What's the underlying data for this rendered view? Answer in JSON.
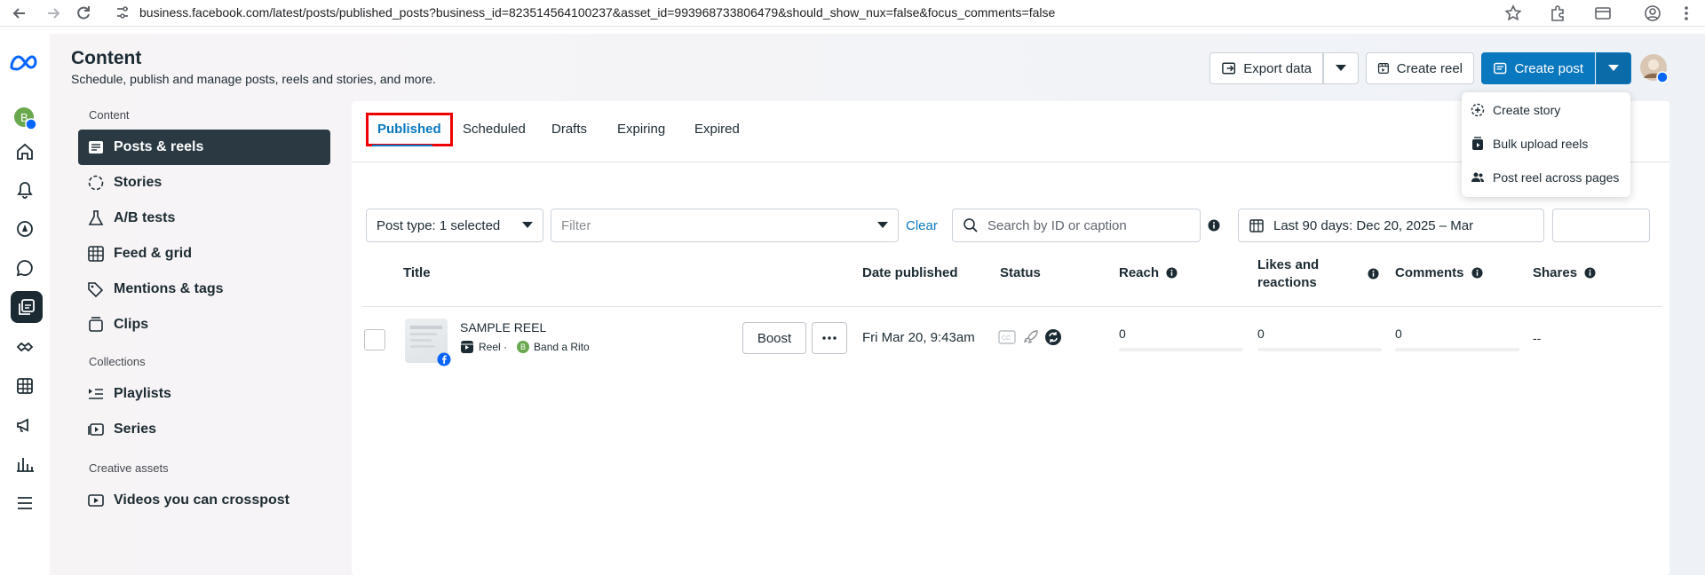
{
  "browser": {
    "url": "business.facebook.com/latest/posts/published_posts?business_id=823514564100237&asset_id=993968733806479&should_show_nux=false&focus_comments=false"
  },
  "header": {
    "title": "Content",
    "subtitle": "Schedule, publish and manage posts, reels and stories, and more.",
    "export_label": "Export data",
    "create_reel_label": "Create reel",
    "create_post_label": "Create post"
  },
  "sidebar": {
    "section_content": "Content",
    "section_collections": "Collections",
    "section_creative": "Creative assets",
    "items": [
      {
        "label": "Posts & reels",
        "icon": "posts-icon"
      },
      {
        "label": "Stories",
        "icon": "stories-icon"
      },
      {
        "label": "A/B tests",
        "icon": "flask-icon"
      },
      {
        "label": "Feed & grid",
        "icon": "grid-icon"
      },
      {
        "label": "Mentions & tags",
        "icon": "tag-icon"
      },
      {
        "label": "Clips",
        "icon": "clips-icon"
      },
      {
        "label": "Playlists",
        "icon": "playlist-icon"
      },
      {
        "label": "Series",
        "icon": "series-icon"
      },
      {
        "label": "Videos you can crosspost",
        "icon": "video-icon"
      }
    ]
  },
  "tabs": [
    "Published",
    "Scheduled",
    "Drafts",
    "Expiring",
    "Expired"
  ],
  "filters": {
    "post_type": "Post type: 1 selected",
    "filter_placeholder": "Filter",
    "clear_label": "Clear",
    "search_placeholder": "Search by ID or caption",
    "date_range": "Last 90 days: Dec 20, 2025 – Mar"
  },
  "table": {
    "columns": {
      "title": "Title",
      "date_published": "Date published",
      "status": "Status",
      "reach": "Reach",
      "likes_1": "Likes and",
      "likes_2": "reactions",
      "comments": "Comments",
      "shares": "Shares"
    },
    "rows": [
      {
        "title": "SAMPLE REEL",
        "type": "Reel ·",
        "page_initial": "B",
        "page": "Band a Rito",
        "boost_label": "Boost",
        "date": "Fri Mar 20, 9:43am",
        "reach": "0",
        "likes": "0",
        "comments": "0",
        "shares": "--"
      }
    ]
  },
  "menu": {
    "items": [
      "Create story",
      "Bulk upload reels",
      "Post reel across pages"
    ]
  },
  "colors": {
    "accent": "#0a78be",
    "active_nav": "#2a3942",
    "highlight_border": "#ee0000"
  }
}
